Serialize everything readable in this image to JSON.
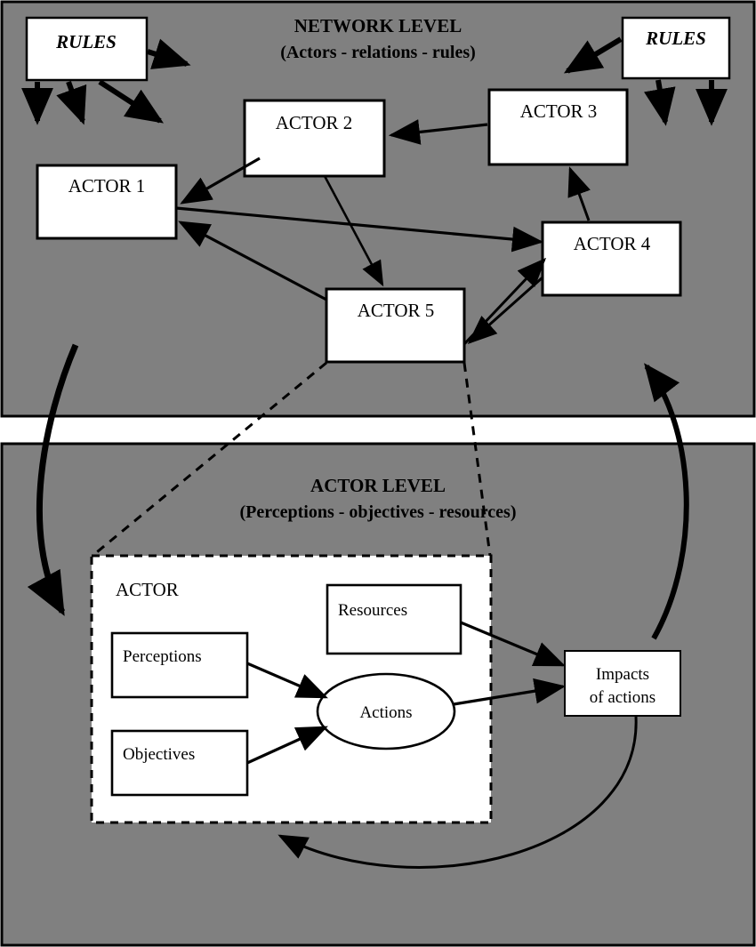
{
  "figure": {
    "title_network": "NETWORK LEVEL",
    "subtitle_network": "(Actors - relations - rules)",
    "title_actor": "ACTOR LEVEL",
    "subtitle_actor": "(Perceptions - objectives - resources)"
  },
  "colors": {
    "background_panel": "#808080",
    "page_background": "#ffffff",
    "box_fill": "#ffffff",
    "stroke": "#000000"
  },
  "network_level": {
    "rules_left": "RULES",
    "rules_right": "RULES",
    "actors": [
      {
        "id": "actor1",
        "label": "ACTOR 1"
      },
      {
        "id": "actor2",
        "label": "ACTOR 2"
      },
      {
        "id": "actor3",
        "label": "ACTOR 3"
      },
      {
        "id": "actor4",
        "label": "ACTOR 4"
      },
      {
        "id": "actor5",
        "label": "ACTOR 5"
      }
    ]
  },
  "actor_level": {
    "container_label": "ACTOR",
    "nodes": [
      {
        "id": "perceptions",
        "label": "Perceptions"
      },
      {
        "id": "objectives",
        "label": "Objectives"
      },
      {
        "id": "resources",
        "label": "Resources"
      },
      {
        "id": "actions",
        "label": "Actions"
      },
      {
        "id": "impacts",
        "label": "Impacts"
      },
      {
        "id": "impacts_line2",
        "label": "of actions"
      }
    ],
    "impacts_full_label": "Impacts of actions"
  }
}
